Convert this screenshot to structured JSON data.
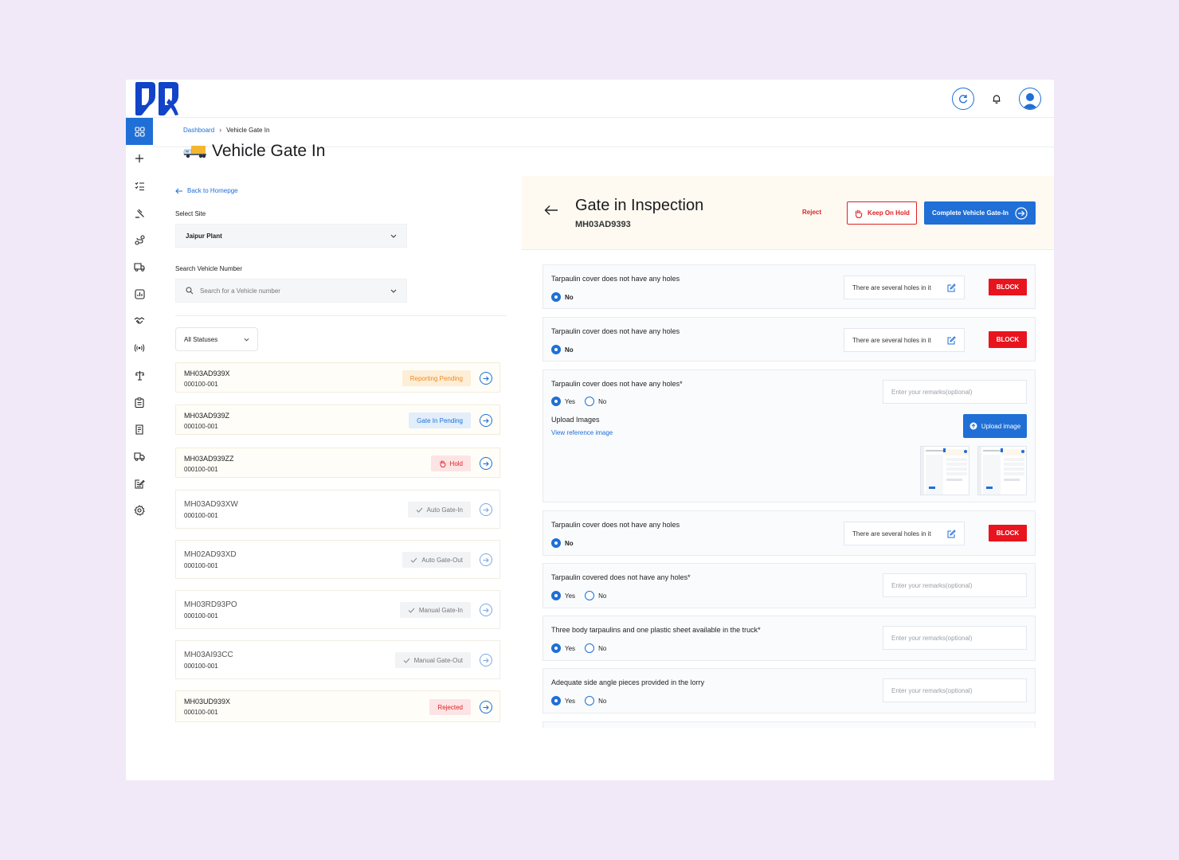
{
  "breadcrumb": {
    "home": "Dashboard",
    "current": "Vehicle Gate In"
  },
  "page": {
    "title": "Vehicle Gate In"
  },
  "left": {
    "back": "Back to Homepge",
    "site_label": "Select Site",
    "site_value": "Jaipur Plant",
    "search_label": "Search Vehicle Number",
    "search_placeholder": "Search for a Vehicle number",
    "status_filter": "All Statuses"
  },
  "vehicles": [
    {
      "number": "MH03AD939X",
      "code": "000100-001",
      "status": "Reporting Pending"
    },
    {
      "number": "MH03AD939Z",
      "code": "000100-001",
      "status": "Gate In Pending"
    },
    {
      "number": "MH03AD939ZZ",
      "code": "000100-001",
      "status": "Hold"
    },
    {
      "number": "MH03AD93XW",
      "code": "000100-001",
      "status": "Auto Gate-In"
    },
    {
      "number": "MH02AD93XD",
      "code": "000100-001",
      "status": "Auto Gate-Out"
    },
    {
      "number": "MH03RD93PO",
      "code": "000100-001",
      "status": "Manual Gate-In"
    },
    {
      "number": "MH03AI93CC",
      "code": "000100-001",
      "status": "Manual Gate-Out"
    },
    {
      "number": "MH03UD939X",
      "code": "000100-001",
      "status": "Rejected"
    }
  ],
  "inspection": {
    "title": "Gate in Inspection",
    "vehicle": "MH03AD9393",
    "reject": "Reject",
    "hold": "Keep On Hold",
    "complete": "Complete Vehicle Gate-In"
  },
  "labels": {
    "yes": "Yes",
    "no": "No",
    "block": "BLOCK",
    "remark_placeholder": "Enter your remarks(optional)",
    "upload_images": "Upload Images",
    "view_reference": "View reference image",
    "upload_button": "Upload image"
  },
  "checks": [
    {
      "question": "Tarpaulin cover does not have any holes",
      "answer": "No",
      "remark": "There are several holes in it"
    },
    {
      "question": "Tarpaulin cover does not have any holes",
      "answer": "No",
      "remark": "There are several holes in it"
    },
    {
      "question": "Tarpaulin cover does not have any holes*",
      "answer": "Yes"
    },
    {
      "question": "Tarpaulin cover does not have any holes",
      "answer": "No",
      "remark": "There are several holes in it"
    },
    {
      "question": "Tarpaulin covered does not have any holes*",
      "answer": "Yes"
    },
    {
      "question": "Three body tarpaulins and one plastic sheet available in the truck*",
      "answer": "Yes"
    },
    {
      "question": "Adequate side angle pieces provided in the lorry",
      "answer": "Yes"
    }
  ],
  "colors": {
    "primary": "#1f6fd6",
    "danger": "#e8141e",
    "background": "#f1e8f8"
  }
}
